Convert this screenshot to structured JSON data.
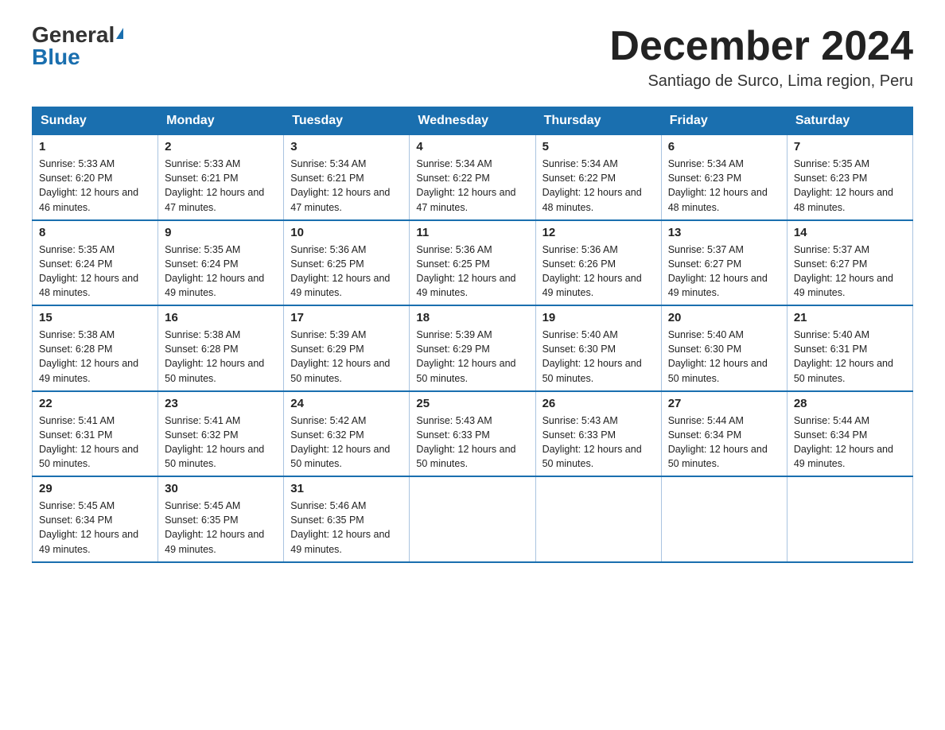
{
  "logo": {
    "general": "General",
    "blue": "Blue",
    "triangle": "▶"
  },
  "title": "December 2024",
  "subtitle": "Santiago de Surco, Lima region, Peru",
  "weekdays": [
    "Sunday",
    "Monday",
    "Tuesday",
    "Wednesday",
    "Thursday",
    "Friday",
    "Saturday"
  ],
  "weeks": [
    [
      {
        "day": "1",
        "sunrise": "5:33 AM",
        "sunset": "6:20 PM",
        "daylight": "12 hours and 46 minutes."
      },
      {
        "day": "2",
        "sunrise": "5:33 AM",
        "sunset": "6:21 PM",
        "daylight": "12 hours and 47 minutes."
      },
      {
        "day": "3",
        "sunrise": "5:34 AM",
        "sunset": "6:21 PM",
        "daylight": "12 hours and 47 minutes."
      },
      {
        "day": "4",
        "sunrise": "5:34 AM",
        "sunset": "6:22 PM",
        "daylight": "12 hours and 47 minutes."
      },
      {
        "day": "5",
        "sunrise": "5:34 AM",
        "sunset": "6:22 PM",
        "daylight": "12 hours and 48 minutes."
      },
      {
        "day": "6",
        "sunrise": "5:34 AM",
        "sunset": "6:23 PM",
        "daylight": "12 hours and 48 minutes."
      },
      {
        "day": "7",
        "sunrise": "5:35 AM",
        "sunset": "6:23 PM",
        "daylight": "12 hours and 48 minutes."
      }
    ],
    [
      {
        "day": "8",
        "sunrise": "5:35 AM",
        "sunset": "6:24 PM",
        "daylight": "12 hours and 48 minutes."
      },
      {
        "day": "9",
        "sunrise": "5:35 AM",
        "sunset": "6:24 PM",
        "daylight": "12 hours and 49 minutes."
      },
      {
        "day": "10",
        "sunrise": "5:36 AM",
        "sunset": "6:25 PM",
        "daylight": "12 hours and 49 minutes."
      },
      {
        "day": "11",
        "sunrise": "5:36 AM",
        "sunset": "6:25 PM",
        "daylight": "12 hours and 49 minutes."
      },
      {
        "day": "12",
        "sunrise": "5:36 AM",
        "sunset": "6:26 PM",
        "daylight": "12 hours and 49 minutes."
      },
      {
        "day": "13",
        "sunrise": "5:37 AM",
        "sunset": "6:27 PM",
        "daylight": "12 hours and 49 minutes."
      },
      {
        "day": "14",
        "sunrise": "5:37 AM",
        "sunset": "6:27 PM",
        "daylight": "12 hours and 49 minutes."
      }
    ],
    [
      {
        "day": "15",
        "sunrise": "5:38 AM",
        "sunset": "6:28 PM",
        "daylight": "12 hours and 49 minutes."
      },
      {
        "day": "16",
        "sunrise": "5:38 AM",
        "sunset": "6:28 PM",
        "daylight": "12 hours and 50 minutes."
      },
      {
        "day": "17",
        "sunrise": "5:39 AM",
        "sunset": "6:29 PM",
        "daylight": "12 hours and 50 minutes."
      },
      {
        "day": "18",
        "sunrise": "5:39 AM",
        "sunset": "6:29 PM",
        "daylight": "12 hours and 50 minutes."
      },
      {
        "day": "19",
        "sunrise": "5:40 AM",
        "sunset": "6:30 PM",
        "daylight": "12 hours and 50 minutes."
      },
      {
        "day": "20",
        "sunrise": "5:40 AM",
        "sunset": "6:30 PM",
        "daylight": "12 hours and 50 minutes."
      },
      {
        "day": "21",
        "sunrise": "5:40 AM",
        "sunset": "6:31 PM",
        "daylight": "12 hours and 50 minutes."
      }
    ],
    [
      {
        "day": "22",
        "sunrise": "5:41 AM",
        "sunset": "6:31 PM",
        "daylight": "12 hours and 50 minutes."
      },
      {
        "day": "23",
        "sunrise": "5:41 AM",
        "sunset": "6:32 PM",
        "daylight": "12 hours and 50 minutes."
      },
      {
        "day": "24",
        "sunrise": "5:42 AM",
        "sunset": "6:32 PM",
        "daylight": "12 hours and 50 minutes."
      },
      {
        "day": "25",
        "sunrise": "5:43 AM",
        "sunset": "6:33 PM",
        "daylight": "12 hours and 50 minutes."
      },
      {
        "day": "26",
        "sunrise": "5:43 AM",
        "sunset": "6:33 PM",
        "daylight": "12 hours and 50 minutes."
      },
      {
        "day": "27",
        "sunrise": "5:44 AM",
        "sunset": "6:34 PM",
        "daylight": "12 hours and 50 minutes."
      },
      {
        "day": "28",
        "sunrise": "5:44 AM",
        "sunset": "6:34 PM",
        "daylight": "12 hours and 49 minutes."
      }
    ],
    [
      {
        "day": "29",
        "sunrise": "5:45 AM",
        "sunset": "6:34 PM",
        "daylight": "12 hours and 49 minutes."
      },
      {
        "day": "30",
        "sunrise": "5:45 AM",
        "sunset": "6:35 PM",
        "daylight": "12 hours and 49 minutes."
      },
      {
        "day": "31",
        "sunrise": "5:46 AM",
        "sunset": "6:35 PM",
        "daylight": "12 hours and 49 minutes."
      },
      null,
      null,
      null,
      null
    ]
  ],
  "labels": {
    "sunrise": "Sunrise:",
    "sunset": "Sunset:",
    "daylight": "Daylight:"
  }
}
